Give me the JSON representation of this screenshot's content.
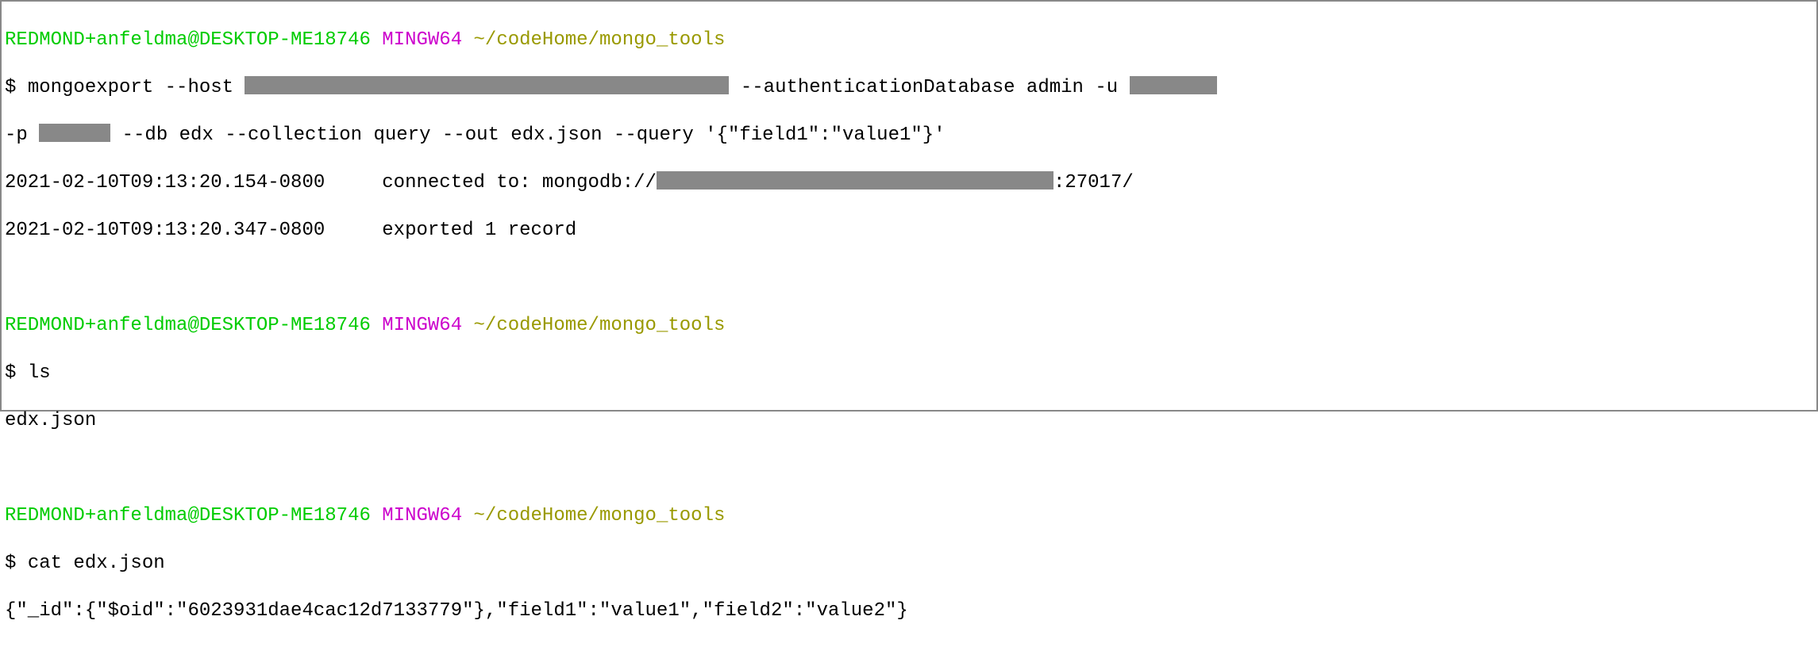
{
  "prompts": [
    {
      "user": "REDMOND+anfeldma@DESKTOP-ME18746",
      "sys": "MINGW64",
      "path": "~/codeHome/mongo_tools"
    },
    {
      "user": "REDMOND+anfeldma@DESKTOP-ME18746",
      "sys": "MINGW64",
      "path": "~/codeHome/mongo_tools"
    },
    {
      "user": "REDMOND+anfeldma@DESKTOP-ME18746",
      "sys": "MINGW64",
      "path": "~/codeHome/mongo_tools"
    }
  ],
  "cmd1": {
    "dollar": "$ ",
    "part1": "mongoexport --host ",
    "part2": " --authenticationDatabase admin -u ",
    "line2a": "-p ",
    "line2b": " --db edx --collection query --out edx.json --query '{\"field1\":\"value1\"}'"
  },
  "out1": {
    "line1a": "2021-02-10T09:13:20.154-0800     connected to: mongodb://",
    "line1b": ":27017/",
    "line2": "2021-02-10T09:13:20.347-0800     exported 1 record"
  },
  "cmd2": {
    "dollar": "$ ",
    "text": "ls"
  },
  "out2": {
    "line1": "edx.json"
  },
  "cmd3": {
    "dollar": "$ ",
    "text": "cat edx.json"
  },
  "out3": {
    "line1": "{\"_id\":{\"$oid\":\"6023931dae4cac12d7133779\"},\"field1\":\"value1\",\"field2\":\"value2\"}"
  }
}
